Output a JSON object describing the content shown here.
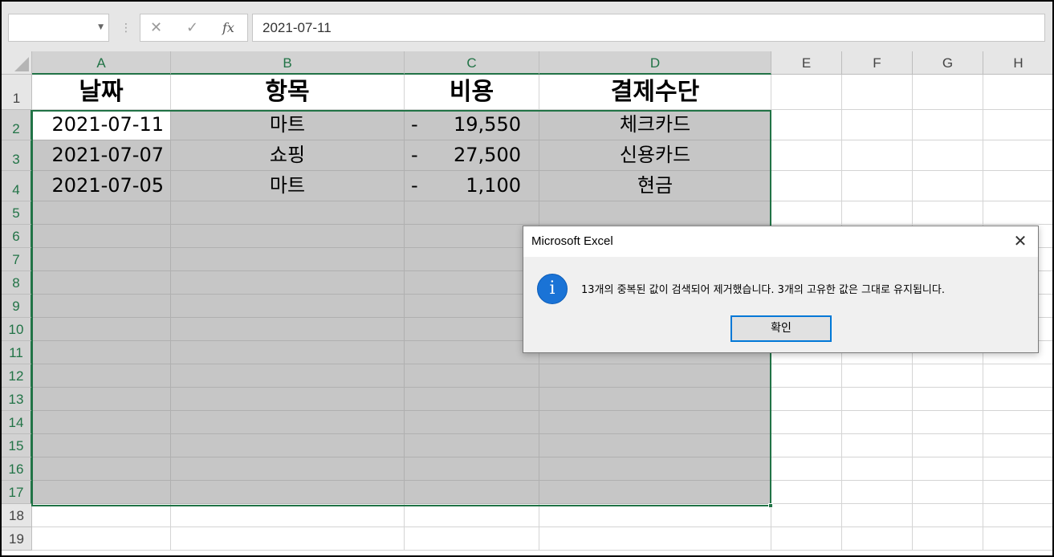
{
  "formula_bar": {
    "name_box": "",
    "cancel_icon": "✕",
    "enter_icon": "✓",
    "fx_label": "fx",
    "formula": "2021-07-11"
  },
  "columns": [
    "A",
    "B",
    "C",
    "D",
    "E",
    "F",
    "G",
    "H"
  ],
  "rows": [
    "1",
    "2",
    "3",
    "4",
    "5",
    "6",
    "7",
    "8",
    "9",
    "10",
    "11",
    "12",
    "13",
    "14",
    "15",
    "16",
    "17",
    "18",
    "19"
  ],
  "headers": [
    "날짜",
    "항목",
    "비용",
    "결제수단"
  ],
  "records": [
    {
      "date": "2021-07-11",
      "item": "마트",
      "cost_sign": "-",
      "cost": "19,550",
      "payment": "체크카드"
    },
    {
      "date": "2021-07-07",
      "item": "쇼핑",
      "cost_sign": "-",
      "cost": "27,500",
      "payment": "신용카드"
    },
    {
      "date": "2021-07-05",
      "item": "마트",
      "cost_sign": "-",
      "cost": "1,100",
      "payment": "현금"
    }
  ],
  "dialog": {
    "title": "Microsoft Excel",
    "close_icon": "✕",
    "info_icon": "i",
    "message": "13개의 중복된 값이 검색되어 제거했습니다. 3개의 고유한 값은 그대로 유지됩니다.",
    "ok_label": "확인"
  },
  "colors": {
    "selection_accent": "#217346",
    "selected_fill": "#c6c6c6",
    "dialog_button_border": "#0078d7",
    "info_icon": "#1a73d6"
  }
}
